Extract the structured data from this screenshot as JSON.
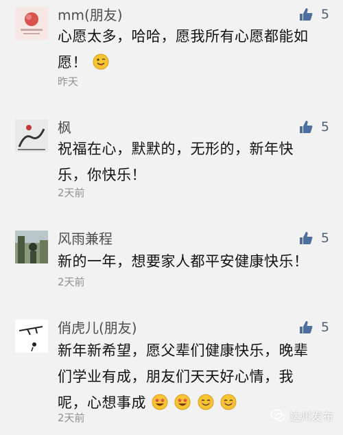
{
  "comments": [
    {
      "name": "mm(朋友)",
      "likes": "5",
      "lines": [
        "心愿太多，哈哈，愿我所有心愿都能如",
        "愿！"
      ],
      "emojis_line2": [
        "tongue-wink-emoji"
      ],
      "time": "昨天",
      "avatar": "pink-flower-avatar"
    },
    {
      "name": "枫",
      "likes": "5",
      "lines": [
        "祝福在心，默默的，无形的，新年快",
        "乐，你快乐！"
      ],
      "time": "2天前",
      "avatar": "ink-painting-avatar"
    },
    {
      "name": "风雨兼程",
      "likes": "5",
      "lines": [
        "新的一年，想要家人都平安健康快乐！"
      ],
      "time": "2天前",
      "avatar": "outdoor-photo-avatar"
    },
    {
      "name": "俏虎儿(朋友)",
      "likes": "5",
      "lines": [
        "新年新希望，愿父辈们健康快乐，晚辈",
        "们学业有成，朋友们天天好心情，我",
        "呢，心想事成"
      ],
      "emojis_line3": [
        "star-struck-emoji",
        "star-struck-emoji",
        "smiling-emoji",
        "smiling-emoji"
      ],
      "time": "2天前",
      "avatar": "branch-sketch-avatar"
    }
  ],
  "watermark": "达州发布",
  "colors": {
    "like_icon": "#4e6e9f",
    "name": "#4e4e4e",
    "time": "#909090",
    "background": "#f2f2f2"
  }
}
